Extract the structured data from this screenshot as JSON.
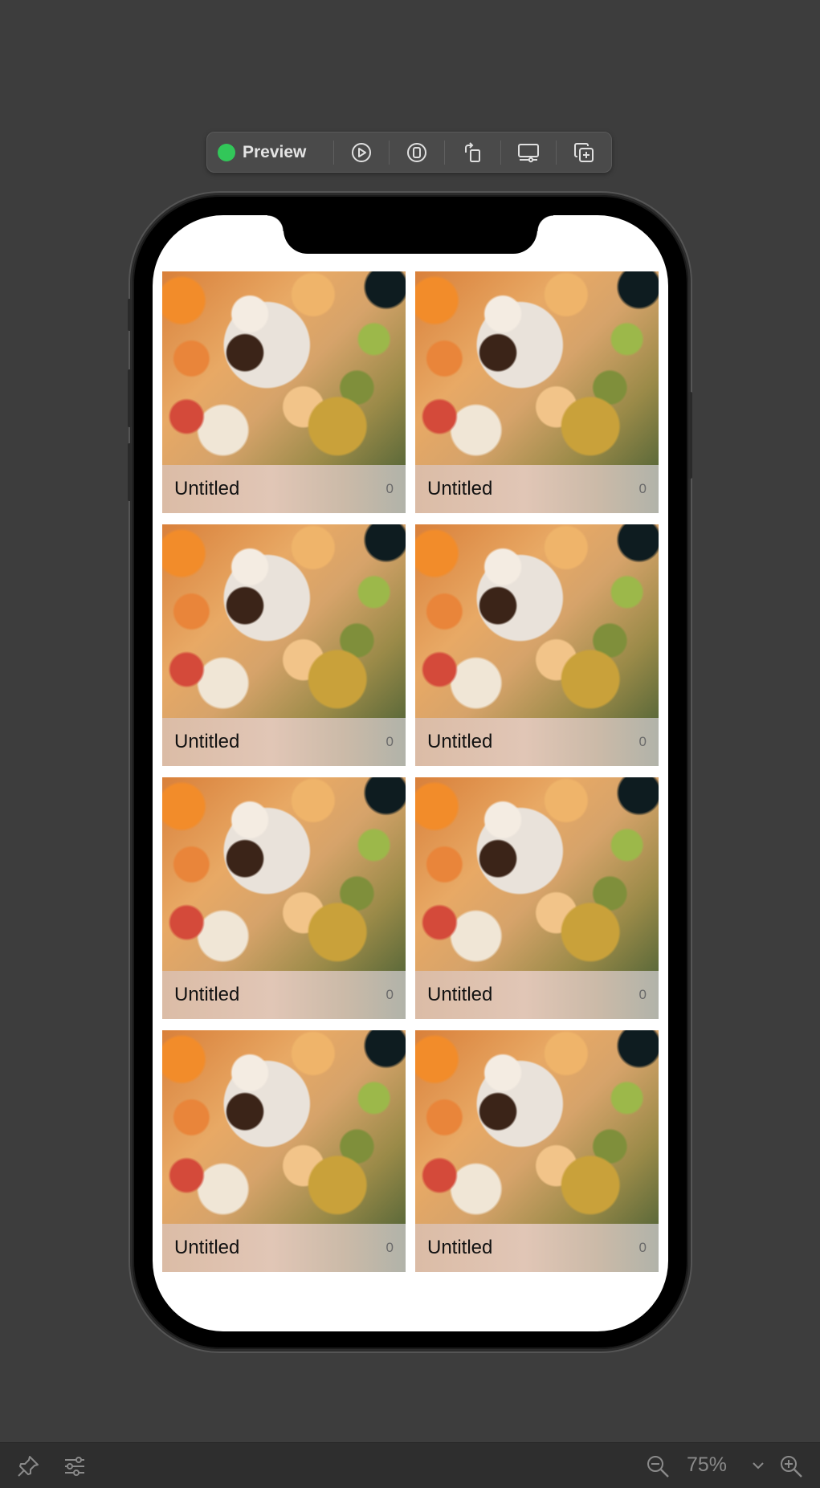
{
  "toolbar": {
    "preview_label": "Preview",
    "buttons": [
      "play-icon",
      "device-icon",
      "rotate-icon",
      "display-settings-icon",
      "duplicate-icon"
    ]
  },
  "colors": {
    "background": "#3d3d3d",
    "live_indicator": "#32c759"
  },
  "cards": [
    {
      "title": "Untitled",
      "count": "0"
    },
    {
      "title": "Untitled",
      "count": "0"
    },
    {
      "title": "Untitled",
      "count": "0"
    },
    {
      "title": "Untitled",
      "count": "0"
    },
    {
      "title": "Untitled",
      "count": "0"
    },
    {
      "title": "Untitled",
      "count": "0"
    },
    {
      "title": "Untitled",
      "count": "0"
    },
    {
      "title": "Untitled",
      "count": "0"
    }
  ],
  "bottom_bar": {
    "zoom_level": "75%"
  }
}
